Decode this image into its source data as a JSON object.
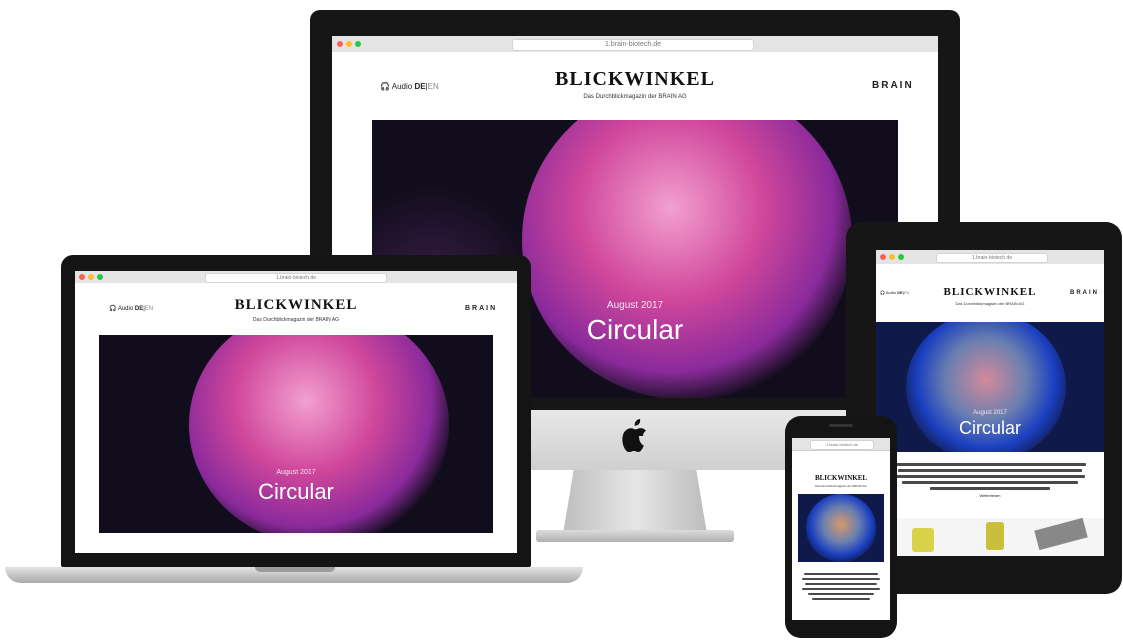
{
  "site": {
    "brand": "BLICKWINKEL",
    "tagline": "Das Durchblickmagazin der BRAIN AG",
    "audio_label": "Audio",
    "lang_de": "DE",
    "lang_en": "EN",
    "lang_separator": "|",
    "brand_right": "BRAIN",
    "url": "1.brain-biotech.de",
    "read_more": "Weiterlesen"
  },
  "hero": {
    "date": "August 2017",
    "title": "Circular"
  },
  "colors": {
    "bezel": "#161616",
    "hero_dark": "#120d1c",
    "hero_pink": "#d0479b",
    "hero_blue": "#1a3fc0",
    "chrome": "#e4e4e4"
  },
  "icons": {
    "audio": "headphones-icon",
    "logo": "apple-logo-icon"
  }
}
